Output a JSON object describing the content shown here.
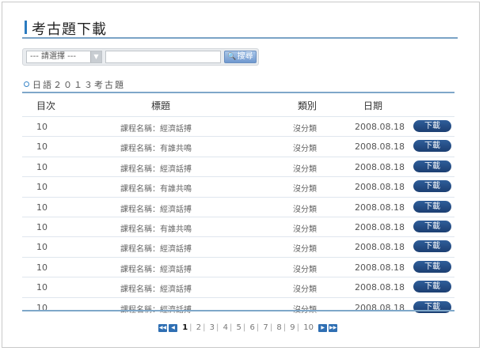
{
  "page": {
    "title": "考古題下載"
  },
  "search": {
    "select_value": "--- 請選擇 ---",
    "input_value": "",
    "button_label": "搜尋"
  },
  "section": {
    "subtitle": "日語２０１３考古題"
  },
  "table": {
    "headers": {
      "num": "目次",
      "title": "標題",
      "category": "類別",
      "date": "日期"
    },
    "download_label": "下載",
    "rows": [
      {
        "num": "10",
        "title": "課程名稱：經濟話搏",
        "category": "沒分類",
        "date": "2008.08.18"
      },
      {
        "num": "10",
        "title": "課程名稱：有誰共鳴",
        "category": "沒分類",
        "date": "2008.08.18"
      },
      {
        "num": "10",
        "title": "課程名稱：經濟話搏",
        "category": "沒分類",
        "date": "2008.08.18"
      },
      {
        "num": "10",
        "title": "課程名稱：有誰共鳴",
        "category": "沒分類",
        "date": "2008.08.18"
      },
      {
        "num": "10",
        "title": "課程名稱：經濟話搏",
        "category": "沒分類",
        "date": "2008.08.18"
      },
      {
        "num": "10",
        "title": "課程名稱：有誰共鳴",
        "category": "沒分類",
        "date": "2008.08.18"
      },
      {
        "num": "10",
        "title": "課程名稱：經濟話搏",
        "category": "沒分類",
        "date": "2008.08.18"
      },
      {
        "num": "10",
        "title": "課程名稱：經濟話搏",
        "category": "沒分類",
        "date": "2008.08.18"
      },
      {
        "num": "10",
        "title": "課程名稱：經濟話搏",
        "category": "沒分類",
        "date": "2008.08.18"
      },
      {
        "num": "10",
        "title": "課程名稱：經濟話搏",
        "category": "沒分類",
        "date": "2008.08.18"
      }
    ]
  },
  "pagination": {
    "pages": [
      "1",
      "2",
      "3",
      "4",
      "5",
      "6",
      "7",
      "8",
      "9",
      "10"
    ],
    "current": "1"
  },
  "colors": {
    "accent": "#2b7bc0",
    "download_button": "#1c3f72",
    "pager_button": "#2f6fb3"
  }
}
